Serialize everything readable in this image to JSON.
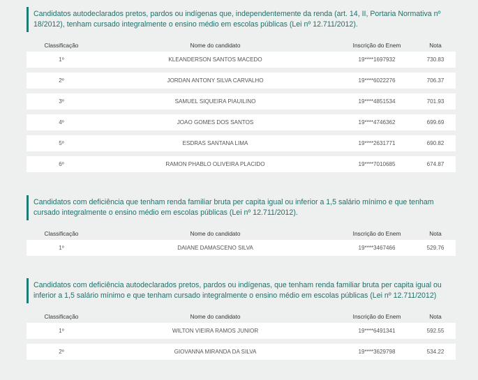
{
  "columns": {
    "classificacao": "Classificação",
    "nome": "Nome do candidato",
    "inscricao": "Inscrição do Enem",
    "nota": "Nota"
  },
  "sections": [
    {
      "title": "Candidatos autodeclarados pretos, pardos ou indígenas que, independentemente da renda (art. 14, II, Portaria Normativa nº 18/2012), tenham cursado integralmente o ensino médio em escolas públicas (Lei nº 12.711/2012).",
      "rows": [
        {
          "classificacao": "1º",
          "nome": "KLEANDERSON SANTOS MACEDO",
          "inscricao": "19****1697932",
          "nota": "730.83"
        },
        {
          "classificacao": "2º",
          "nome": "JORDAN ANTONY SILVA CARVALHO",
          "inscricao": "19****6022276",
          "nota": "706.37"
        },
        {
          "classificacao": "3º",
          "nome": "SAMUEL SIQUEIRA PIAUILINO",
          "inscricao": "19****4851534",
          "nota": "701.93"
        },
        {
          "classificacao": "4º",
          "nome": "JOAO GOMES DOS SANTOS",
          "inscricao": "19****4746362",
          "nota": "699.69"
        },
        {
          "classificacao": "5º",
          "nome": "ESDRAS SANTANA LIMA",
          "inscricao": "19****2631771",
          "nota": "690.82"
        },
        {
          "classificacao": "6º",
          "nome": "RAMON PHABLO OLIVEIRA PLACIDO",
          "inscricao": "19****7010685",
          "nota": "674.87"
        }
      ]
    },
    {
      "title": "Candidatos com deficiência que tenham renda familiar bruta per capita igual ou inferior a 1,5 salário mínimo e que tenham cursado integralmente o ensino médio em escolas públicas (Lei nº 12.711/2012).",
      "rows": [
        {
          "classificacao": "1º",
          "nome": "DAIANE DAMASCENO SILVA",
          "inscricao": "19****3467466",
          "nota": "529.76"
        }
      ]
    },
    {
      "title": "Candidatos com deficiência autodeclarados pretos, pardos ou indígenas, que tenham renda familiar bruta per capita igual ou inferior a 1,5 salário mínimo e que tenham cursado integralmente o ensino médio em escolas públicas (Lei nº 12.711/2012)",
      "rows": [
        {
          "classificacao": "1º",
          "nome": "WILTON VIEIRA RAMOS JUNIOR",
          "inscricao": "19****6491341",
          "nota": "592.55"
        },
        {
          "classificacao": "2º",
          "nome": "GIOVANNA MIRANDA DA SILVA",
          "inscricao": "19****3629798",
          "nota": "534.22"
        }
      ]
    }
  ]
}
